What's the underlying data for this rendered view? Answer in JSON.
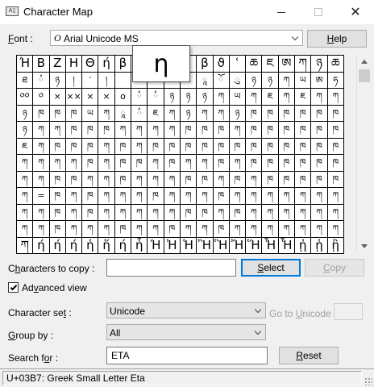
{
  "window": {
    "title": "Character Map",
    "icon_label": "A▯"
  },
  "font_row": {
    "label_prefix": "",
    "label_u": "F",
    "label_rest": "ont :",
    "font_icon": "O",
    "font_value": "Arial Unicode MS",
    "help_u": "H",
    "help_rest": "elp"
  },
  "grid": {
    "zoom_char": "η",
    "rows": [
      [
        "Ή",
        "Β",
        "Ζ",
        "Η",
        "Θ",
        "ή",
        "β",
        "",
        "",
        "",
        "",
        "β",
        "ϑ",
        "ʿ",
        "ཆ",
        "ཇ",
        "ཨ",
        "ཀ",
        "ཉ",
        "ཆ"
      ],
      [
        "ཐ",
        "ཾ",
        "ཉ",
        "།",
        "་",
        "།",
        "",
        "",
        "",
        "",
        "",
        "ཱ",
        "ོ",
        "ུ",
        "ཉ",
        "ཉ",
        "ཀ",
        "ཡ",
        "ཨ",
        "ཧ"
      ],
      [
        "༠༠",
        "༠",
        "×",
        "××",
        "×",
        "×",
        "o",
        "ཾ",
        "ཾ",
        "ཉ",
        "ཉ",
        "ཉ",
        "ཀ",
        "ཡ",
        "ཀ",
        "ཇ",
        "ཀ",
        "ཇ",
        "ཀ",
        "ཀ"
      ],
      [
        "ཉ",
        "ཁ",
        "ཁ",
        "ཁ",
        "ཡ",
        "ཀ",
        "ཱ",
        "ཾ",
        "ཇ",
        "ཀ",
        "ཉ",
        "ཀ",
        "ཀ",
        "ཉ",
        "ཁ",
        "ཁ",
        "ཁ",
        "ཁ",
        "ཁ",
        "ཁ"
      ],
      [
        "ཉ",
        "ཀ",
        "ཀ",
        "ཁ",
        "ཁ",
        "ཁ",
        "ཀ",
        "ཀ",
        "ཀ",
        "ཀ",
        "ཁ",
        "ཁ",
        "ཁ",
        "ཀ",
        "ཁ",
        "ཁ",
        "ཁ",
        "ཁ",
        "ཁ",
        "ཁ"
      ],
      [
        "ཇ",
        "ཀ",
        "ཁ",
        "ཁ",
        "ཁ",
        "ཀ",
        "ཁ",
        "ཀ",
        "ཁ",
        "ཁ",
        "ཁ",
        "ཁ",
        "ཁ",
        "ཁ",
        "ཁ",
        "ཁ",
        "ཁ",
        "ཁ",
        "ཁ",
        "ཁ"
      ],
      [
        "ཀ",
        "ཀ",
        "ཀ",
        "ཀ",
        "ཁ",
        "ཀ",
        "ཁ",
        "ཁ",
        "ཀ",
        "ཁ",
        "ཀ",
        "ཀ",
        "ཁ",
        "ཀ",
        "ཁ",
        "ཁ",
        "ཁ",
        "ཁ",
        "ཁ",
        "ཁ"
      ],
      [
        "ཀ",
        "ཀ",
        "ཁ",
        "ཁ",
        "ཀ",
        "ཀ",
        "ཁ",
        "ཀ",
        "ཀ",
        "ཀ",
        "ཁ",
        "ཁ",
        "ཀ",
        "ཁ",
        "ཀ",
        "ཁ",
        "ཁ",
        "ཁ",
        "ཁ",
        "ཁ"
      ],
      [
        "ཀ",
        "=",
        "ཁ",
        "ཀ",
        "ཁ",
        "ཀ",
        "ཀ",
        "ཀ",
        "ཁ",
        "ཀ",
        "ཀ",
        "ཀ",
        "ཁ",
        "ཀ",
        "ཀ",
        "ཀ",
        "ཀ",
        "ཀ",
        "ཀ",
        "ཀ"
      ],
      [
        "ཀ",
        "ཀ",
        "ཁ",
        "ཀ",
        "ཁ",
        "ཀ",
        "ཀ",
        "ཀ",
        "ཀ",
        "ཀ",
        "ཁ",
        "ཁ",
        "ཀ",
        "ཁ",
        "ཀ",
        "ཀ",
        "ཀ",
        "ཀ",
        "ཀ",
        "ཀ"
      ],
      [
        "ཀ",
        "ཀ",
        "ཁ",
        "ཀ",
        "ཀ",
        "ཀ",
        "ཁ",
        "ཀ",
        "ཀ",
        "ཁ",
        "ཀ",
        "ཀ",
        "ཁ",
        "ཀ",
        "ཀ",
        "ཀ",
        "ཀ",
        "ཀ",
        "ཀ",
        "ཀ"
      ],
      [
        "ཀ",
        "ή",
        "ή",
        "ή",
        "ἡ",
        "ἥ",
        "ή",
        "ἧ",
        "Ή",
        "Ἠ",
        "Ἡ",
        "Ἢ",
        "Ἣ",
        "Ἤ",
        "Ἥ",
        "Ἦ",
        "Ἧ",
        "ᾐ",
        "ᾑ",
        "ᾒ"
      ]
    ]
  },
  "copy_row": {
    "label_u": "h",
    "label_pre": "C",
    "label_post": "aracters to copy :",
    "value": "",
    "select_u": "S",
    "select_rest": "elect",
    "copy_u": "C",
    "copy_rest": "opy"
  },
  "advanced": {
    "checked": true,
    "label_u": "v",
    "label_pre": "Ad",
    "label_post": "anced view"
  },
  "charset_row": {
    "label_u": "t",
    "label_pre": "Character se",
    "label_post": " :",
    "value": "Unicode",
    "goto_pre": "Go to ",
    "goto_u": "U",
    "goto_post": "nicode :",
    "goto_value": ""
  },
  "groupby_row": {
    "label_u": "G",
    "label_rest": "roup by :",
    "value": "All"
  },
  "search_row": {
    "label_pre": "Search f",
    "label_u": "o",
    "label_post": "r :",
    "value": "ETA",
    "reset_u": "R",
    "reset_rest": "eset"
  },
  "status": {
    "text": "U+03B7: Greek Small Letter Eta"
  },
  "colors": {
    "window_bg": "#f0f0f0",
    "accent": "#0078d7"
  }
}
